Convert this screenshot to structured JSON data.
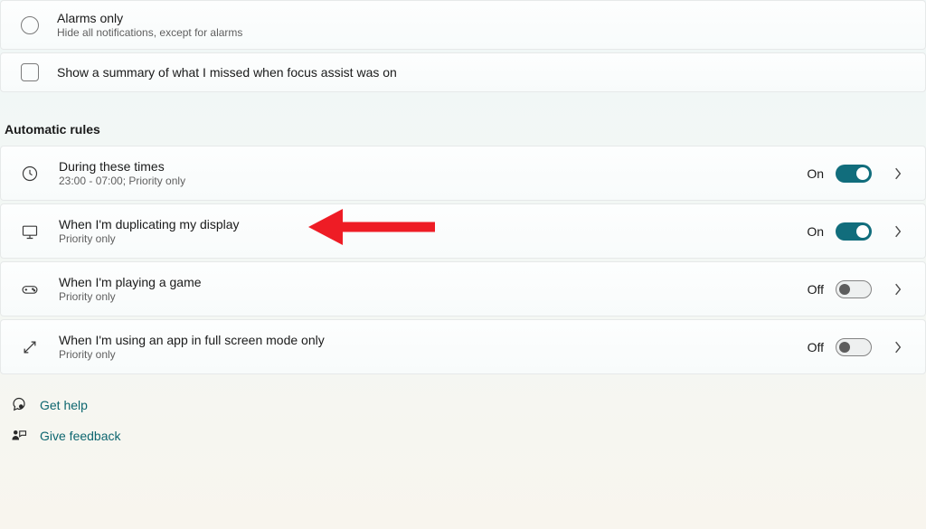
{
  "options": {
    "alarms": {
      "title": "Alarms only",
      "subtitle": "Hide all notifications, except for alarms"
    },
    "summary": {
      "label": "Show a summary of what I missed when focus assist was on"
    }
  },
  "section_header": "Automatic rules",
  "rules": [
    {
      "title": "During these times",
      "subtitle": "23:00 - 07:00; Priority only",
      "state_label": "On",
      "state": "on"
    },
    {
      "title": "When I'm duplicating my display",
      "subtitle": "Priority only",
      "state_label": "On",
      "state": "on"
    },
    {
      "title": "When I'm playing a game",
      "subtitle": "Priority only",
      "state_label": "Off",
      "state": "off"
    },
    {
      "title": "When I'm using an app in full screen mode only",
      "subtitle": "Priority only",
      "state_label": "Off",
      "state": "off"
    }
  ],
  "footer": {
    "help": "Get help",
    "feedback": "Give feedback"
  }
}
